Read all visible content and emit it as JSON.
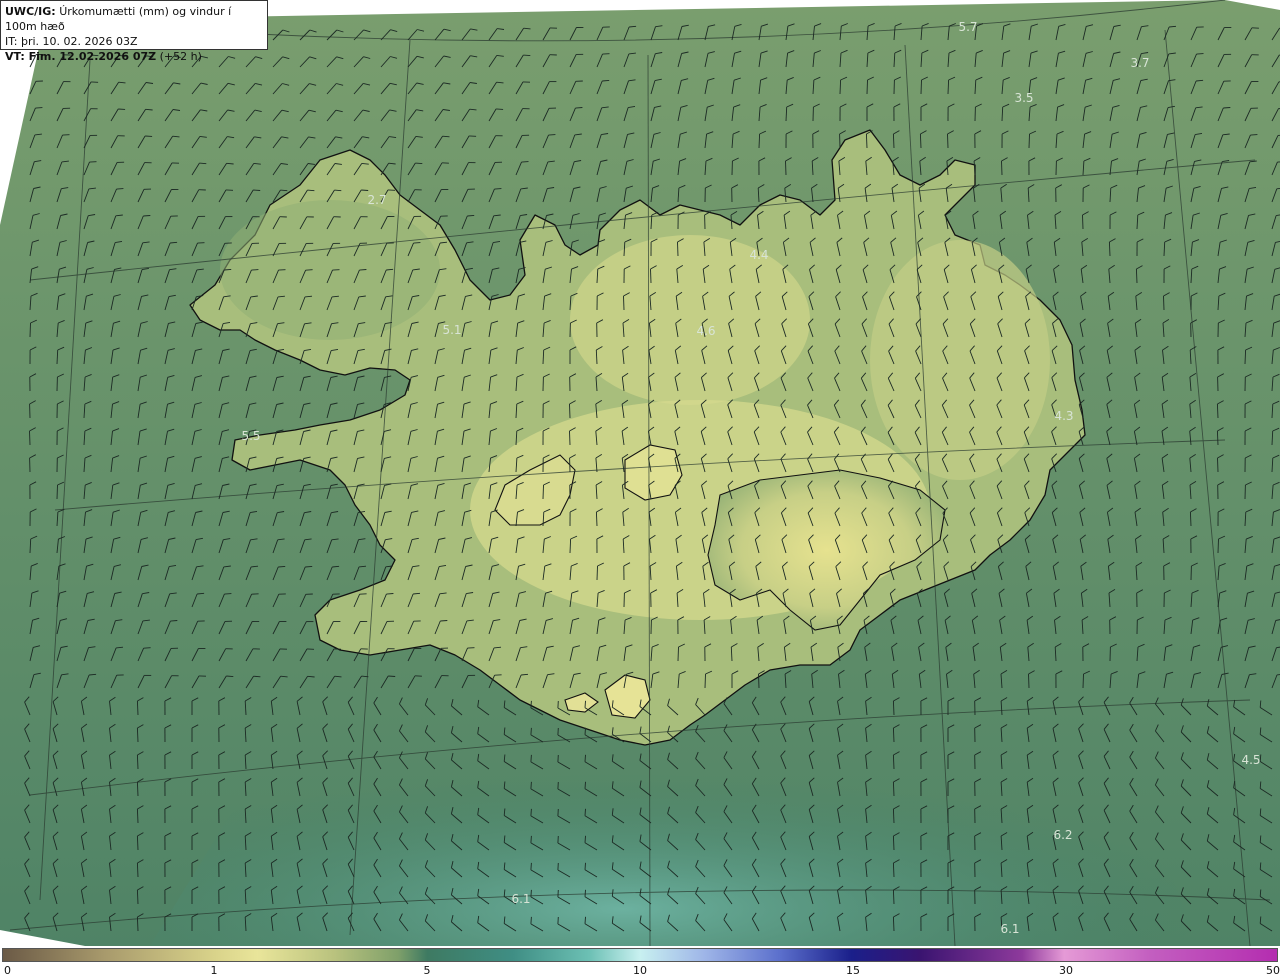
{
  "header": {
    "line1_bold": "UWC/IG:",
    "line1_text": "Úrkomumætti (mm) og vindur í 100m hæð",
    "line2": "IT: þri. 10. 02. 2026 03Z",
    "line3_bold": "VT: Fim. 12.02.2026 07Z",
    "line3_text": "(+52 h)"
  },
  "colorbar": {
    "ticks": [
      "0",
      "1",
      "5",
      "10",
      "15",
      "30",
      "50"
    ]
  },
  "map_values": [
    "5.7",
    "3.7",
    "3.5",
    "2.7",
    "4.4",
    "5.1",
    "4.6",
    "5.5",
    "4.3",
    "4.5",
    "6.2",
    "6.1",
    "6.1"
  ],
  "colors": {
    "ocean": "#3f7f6a",
    "land_high": "#d9dc8e",
    "land_mid": "#a9bd7c",
    "coast": "#111111",
    "graticule": "#2a3a30",
    "barb": "#1c2a24"
  }
}
